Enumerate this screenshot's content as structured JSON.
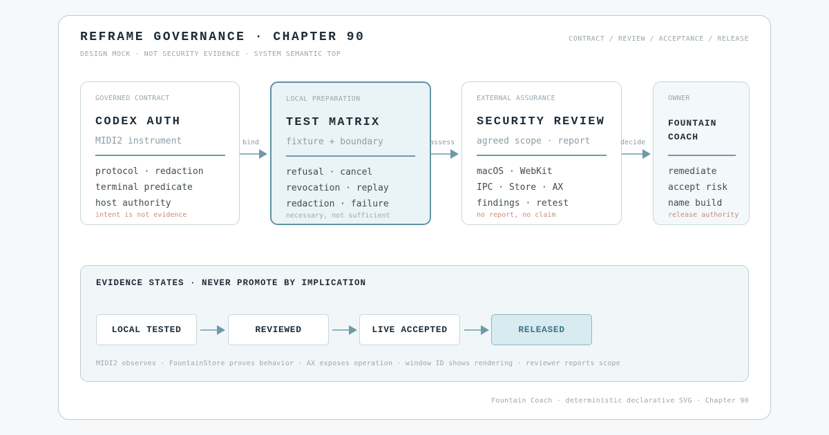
{
  "header": {
    "title": "REFRAME GOVERNANCE · CHAPTER 90",
    "subtitle": "DESIGN MOCK · NOT SECURITY EVIDENCE · SYSTEM SEMANTIC TOP",
    "nav": "CONTRACT / REVIEW / ACCEPTANCE / RELEASE"
  },
  "cards": [
    {
      "lane": "GOVERNED CONTRACT",
      "title": "CODEX AUTH",
      "subtitle": "MIDI2 instrument",
      "items": [
        "protocol · redaction",
        "terminal predicate",
        "host authority"
      ],
      "note": "intent is not evidence"
    },
    {
      "lane": "LOCAL PREPARATION",
      "title": "TEST MATRIX",
      "subtitle": "fixture + boundary",
      "items": [
        "refusal · cancel",
        "revocation · replay",
        "redaction · failure"
      ],
      "note": "necessary, not sufficient"
    },
    {
      "lane": "EXTERNAL ASSURANCE",
      "title": "SECURITY REVIEW",
      "subtitle": "agreed scope · report",
      "items": [
        "macOS · WebKit",
        "IPC · Store · AX",
        "findings · retest"
      ],
      "note": "no report, no claim"
    },
    {
      "lane": "OWNER",
      "title": "FOUNTAIN\nCOACH",
      "items": [
        "remediate",
        "accept risk",
        "name build"
      ],
      "note": "release authority"
    }
  ],
  "connectors": [
    "bind",
    "assess",
    "decide"
  ],
  "evidence": {
    "title": "EVIDENCE STATES · NEVER PROMOTE BY IMPLICATION",
    "states": [
      "LOCAL TESTED",
      "REVIEWED",
      "LIVE ACCEPTED",
      "RELEASED"
    ],
    "caption": "MIDI2 observes · FountainStore proves behavior · AX exposes operation · window ID shows rendering · reviewer reports scope"
  },
  "footer": "Fountain Coach · deterministic declarative SVG · Chapter 90",
  "colors": {
    "accent": "#5f93a3",
    "title": "#1e2c38",
    "muted": "#9aa7ae",
    "warning_note": "#c98a7c",
    "highlight_fill": "#eaf3f6",
    "final_state_fill": "#d8ebf0"
  }
}
